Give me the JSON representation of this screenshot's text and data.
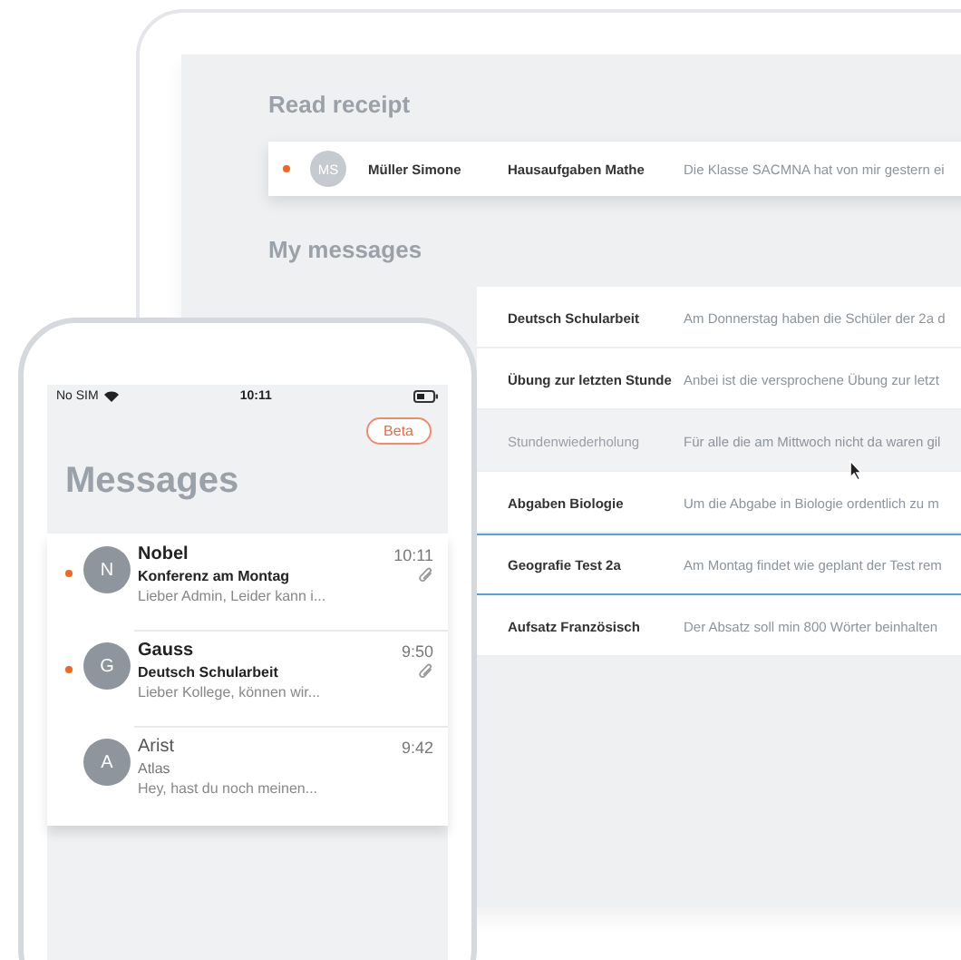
{
  "desktop": {
    "read_receipt": {
      "heading": "Read receipt",
      "row": {
        "unread": true,
        "initials": "MS",
        "sender": "Müller Simone",
        "subject": "Hausaufgaben Mathe",
        "preview": "Die Klasse SACMNA hat von mir gestern ei"
      }
    },
    "my_messages": {
      "heading": "My messages",
      "rows": [
        {
          "subject": "Deutsch Schularbeit",
          "preview": "Am Donnerstag haben die Schüler der 2a d",
          "read": false,
          "selected": false
        },
        {
          "subject": "Übung zur letzten Stunde",
          "preview": "Anbei ist die versprochene Übung zur letzt",
          "read": false,
          "selected": false
        },
        {
          "subject": "Stundenwiederholung",
          "preview": "Für alle die am Mittwoch nicht da waren gil",
          "read": true,
          "selected": false
        },
        {
          "subject": "Abgaben Biologie",
          "preview": "Um die Abgabe in Biologie ordentlich zu m",
          "read": false,
          "selected": false
        },
        {
          "subject": "Geografie Test 2a",
          "preview": "Am Montag findet wie geplant der Test rem",
          "read": false,
          "selected": true
        },
        {
          "subject": "Aufsatz Französisch",
          "preview": "Der Absatz soll min 800 Wörter beinhalten",
          "read": false,
          "selected": false
        }
      ]
    }
  },
  "phone": {
    "status_bar": {
      "carrier": "No SIM",
      "time": "10:11"
    },
    "beta_button": "Beta",
    "title": "Messages",
    "messages": [
      {
        "initial": "N",
        "sender": "Nobel",
        "time": "10:11",
        "subject": "Konferenz am Montag",
        "preview": "Lieber Admin, Leider kann i...",
        "unread": true,
        "attachment": true
      },
      {
        "initial": "G",
        "sender": "Gauss",
        "time": "9:50",
        "subject": "Deutsch Schularbeit",
        "preview": "Lieber Kollege, können wir...",
        "unread": true,
        "attachment": true
      },
      {
        "initial": "A",
        "sender": "Arist",
        "time": "9:42",
        "subject": "Atlas",
        "preview": "Hey,   hast du noch meinen...",
        "unread": false,
        "attachment": false
      }
    ]
  }
}
